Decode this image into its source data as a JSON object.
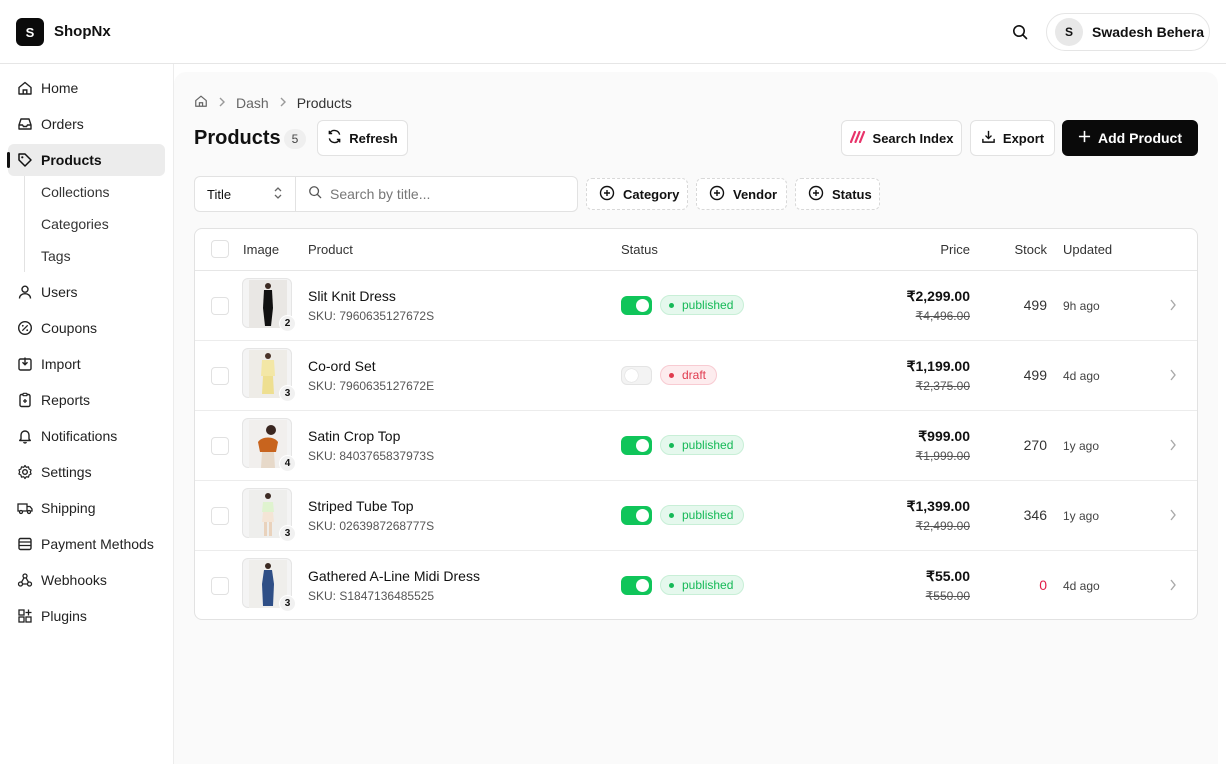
{
  "app": {
    "logo_letter": "S",
    "brand": "ShopNx"
  },
  "user": {
    "initial": "S",
    "name": "Swadesh Behera"
  },
  "sidebar": {
    "items": [
      {
        "label": "Home",
        "icon": "home-icon"
      },
      {
        "label": "Orders",
        "icon": "inbox-icon"
      },
      {
        "label": "Products",
        "icon": "tag-icon",
        "active": true
      },
      {
        "label": "Users",
        "icon": "user-icon"
      },
      {
        "label": "Coupons",
        "icon": "percent-icon"
      },
      {
        "label": "Import",
        "icon": "import-icon"
      },
      {
        "label": "Reports",
        "icon": "clipboard-icon"
      },
      {
        "label": "Notifications",
        "icon": "bell-icon"
      },
      {
        "label": "Settings",
        "icon": "gear-icon"
      },
      {
        "label": "Shipping",
        "icon": "truck-icon"
      },
      {
        "label": "Payment Methods",
        "icon": "wallet-icon"
      },
      {
        "label": "Webhooks",
        "icon": "webhook-icon"
      },
      {
        "label": "Plugins",
        "icon": "grid-plus-icon"
      }
    ],
    "sub_items": [
      "Collections",
      "Categories",
      "Tags"
    ]
  },
  "breadcrumb": {
    "home_icon": "home-icon",
    "items": [
      "Dash",
      "Products"
    ]
  },
  "page": {
    "title": "Products",
    "count": "5"
  },
  "toolbar": {
    "refresh_label": "Refresh",
    "search_index_label": "Search Index",
    "export_label": "Export",
    "add_product_label": "Add Product"
  },
  "filters": {
    "field_select": "Title",
    "search_placeholder": "Search by title...",
    "chips": [
      "Category",
      "Vendor",
      "Status"
    ]
  },
  "table": {
    "columns": [
      "Image",
      "Product",
      "Status",
      "Price",
      "Stock",
      "Updated"
    ],
    "rows": [
      {
        "name": "Slit Knit Dress",
        "sku": "SKU: 7960635127672S",
        "image_count": "2",
        "enabled": true,
        "status": "published",
        "price": "₹2,299.00",
        "mrp": "₹4,496.00",
        "stock": "499",
        "updated": "9h ago"
      },
      {
        "name": "Co-ord Set",
        "sku": "SKU: 7960635127672E",
        "image_count": "3",
        "enabled": false,
        "status": "draft",
        "price": "₹1,199.00",
        "mrp": "₹2,375.00",
        "stock": "499",
        "updated": "4d ago"
      },
      {
        "name": "Satin Crop Top",
        "sku": "SKU: 8403765837973S",
        "image_count": "4",
        "enabled": true,
        "status": "published",
        "price": "₹999.00",
        "mrp": "₹1,999.00",
        "stock": "270",
        "updated": "1y ago"
      },
      {
        "name": "Striped Tube Top",
        "sku": "SKU: 0263987268777S",
        "image_count": "3",
        "enabled": true,
        "status": "published",
        "price": "₹1,399.00",
        "mrp": "₹2,499.00",
        "stock": "346",
        "updated": "1y ago"
      },
      {
        "name": "Gathered A-Line Midi Dress",
        "sku": "SKU: S1847136485525",
        "image_count": "3",
        "enabled": true,
        "status": "published",
        "price": "₹55.00",
        "mrp": "₹550.00",
        "stock": "0",
        "updated": "4d ago"
      }
    ]
  },
  "colors": {
    "primary": "#0a0a0a",
    "published": "#15b957",
    "draft": "#e03a4e",
    "toggle_on": "#10c55a",
    "out_of_stock": "#e11d48"
  }
}
